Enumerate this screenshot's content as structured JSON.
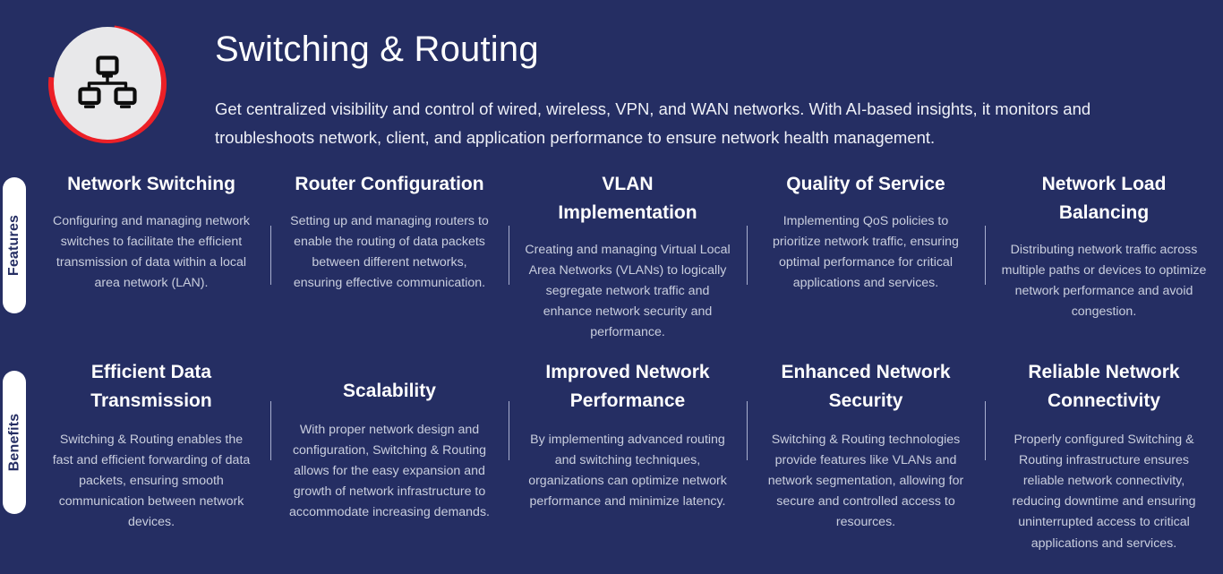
{
  "theme": {
    "background": "#252e63",
    "accent_red": "#ec2027",
    "disc": "#e8e8ea",
    "title_color": "#ffffff",
    "body_color": "#c9cede",
    "divider": "#a9b0cf"
  },
  "header": {
    "icon": "network-topology-icon",
    "title": "Switching & Routing",
    "subtitle": "Get centralized visibility and control of wired, wireless, VPN, and WAN networks. With AI-based insights, it monitors and troubleshoots network, client, and application performance to ensure network health management."
  },
  "sections": [
    {
      "label": "Features",
      "cards": [
        {
          "title": "Network Switching",
          "desc": "Configuring and managing network switches to facilitate the efficient transmission of data within a local area network (LAN)."
        },
        {
          "title": "Router Configuration",
          "desc": "Setting up and managing routers to enable the routing of data packets between different networks, ensuring effective communication."
        },
        {
          "title": "VLAN Implementation",
          "desc": "Creating and managing Virtual Local Area Networks (VLANs) to logically segregate network traffic and enhance network security and performance."
        },
        {
          "title": "Quality of Service",
          "desc": "Implementing QoS policies to prioritize network traffic, ensuring optimal performance for critical applications and services."
        },
        {
          "title": "Network Load Balancing",
          "desc": "Distributing network traffic across multiple paths or devices to optimize network performance and avoid congestion."
        }
      ]
    },
    {
      "label": "Benefits",
      "cards": [
        {
          "title": "Efficient Data Transmission",
          "desc": "Switching & Routing enables the fast and efficient forwarding of data packets, ensuring smooth communication between network devices."
        },
        {
          "title": "Scalability",
          "desc": "With proper network design and configuration, Switching & Routing allows for the easy expansion and growth of network infrastructure to accommodate increasing demands."
        },
        {
          "title": "Improved Network Performance",
          "desc": "By implementing advanced routing and switching techniques, organizations can optimize network performance and minimize latency."
        },
        {
          "title": "Enhanced Network Security",
          "desc": "Switching & Routing technologies provide features like VLANs and network segmentation, allowing for secure and controlled access to resources."
        },
        {
          "title": "Reliable Network Connectivity",
          "desc": "Properly configured Switching & Routing infrastructure ensures reliable network connectivity, reducing downtime and ensuring uninterrupted access to critical applications and services."
        }
      ]
    }
  ]
}
